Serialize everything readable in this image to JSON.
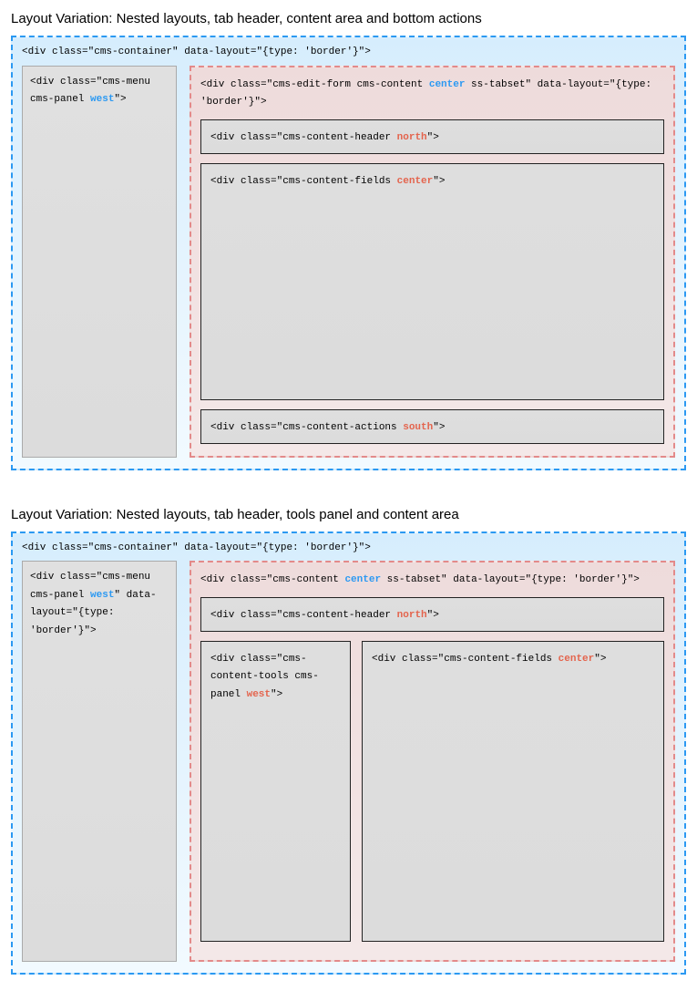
{
  "diagram1": {
    "heading": "Layout Variation: Nested layouts, tab header, content area and bottom actions",
    "outer_pre": "<div class=\"cms-container\" data-layout=\"{type: 'border'}\">",
    "menu_pre": "<div class=\"cms-menu cms-panel ",
    "menu_kw": "west",
    "menu_post": "\">",
    "content_pre": "<div class=\"cms-edit-form cms-content ",
    "content_kw": "center",
    "content_post": " ss-tabset\" data-layout=\"{type: 'border'}\">",
    "header_pre": "<div class=\"cms-content-header ",
    "header_kw": "north",
    "header_post": "\">",
    "fields_pre": "<div class=\"cms-content-fields ",
    "fields_kw": "center",
    "fields_post": "\">",
    "actions_pre": "<div class=\"cms-content-actions ",
    "actions_kw": "south",
    "actions_post": "\">"
  },
  "diagram2": {
    "heading": "Layout Variation: Nested layouts, tab header, tools panel and content area",
    "outer_pre": "<div class=\"cms-container\" data-layout=\"{type: 'border'}\">",
    "menu_pre": "<div class=\"cms-menu cms-panel ",
    "menu_kw": "west",
    "menu_post": "\" data-layout=\"{type: 'border'}\">",
    "content_pre": "<div class=\"cms-content ",
    "content_kw": "center",
    "content_post": " ss-tabset\" data-layout=\"{type: 'border'}\">",
    "header_pre": "<div class=\"cms-content-header ",
    "header_kw": "north",
    "header_post": "\">",
    "tools_pre": "<div class=\"cms-content-tools cms-panel ",
    "tools_kw": "west",
    "tools_post": "\">",
    "fields_pre": "<div class=\"cms-content-fields ",
    "fields_kw": "center",
    "fields_post": "\">"
  }
}
